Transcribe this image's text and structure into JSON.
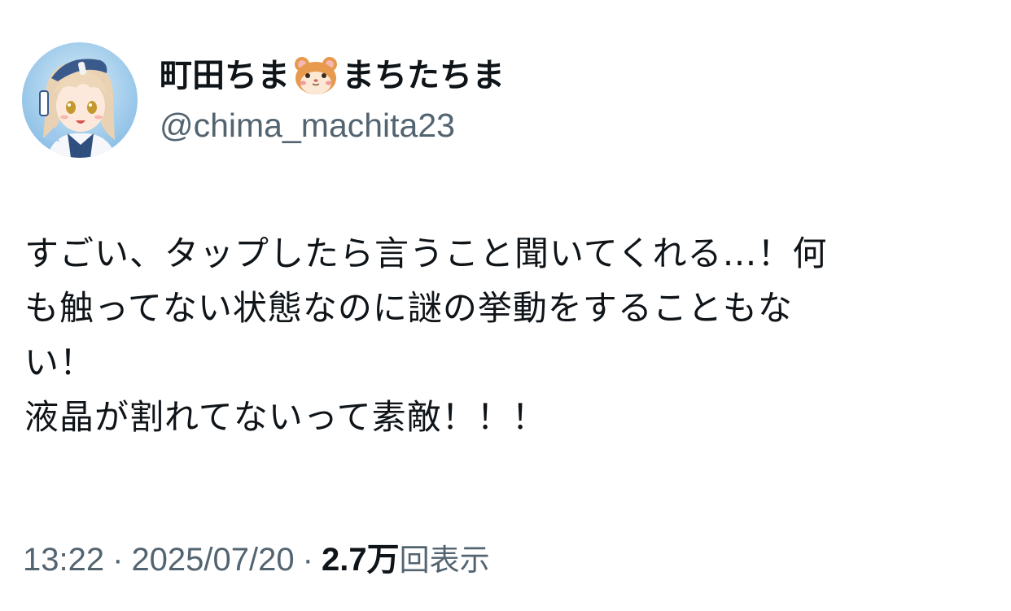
{
  "tweet": {
    "author": {
      "display_name_part1": "町田ちま",
      "display_name_emoji": "hamster-face-emoji",
      "display_name_part2": "まちたちま",
      "handle": "@chima_machita23",
      "avatar": "anime-girl-avatar"
    },
    "body_lines": [
      "すごい、タップしたら言うこと聞いてくれる…！何",
      "も触ってない状態なのに謎の挙動をすることもな",
      "い！",
      "液晶が割れてないって素敵！！！"
    ],
    "meta": {
      "time": "13:22",
      "separator": "·",
      "date": "2025/07/20",
      "views_count": "2.7万",
      "views_label": "回表示"
    }
  },
  "colors": {
    "text_primary": "#0f1419",
    "text_secondary": "#536471",
    "background": "#ffffff"
  }
}
